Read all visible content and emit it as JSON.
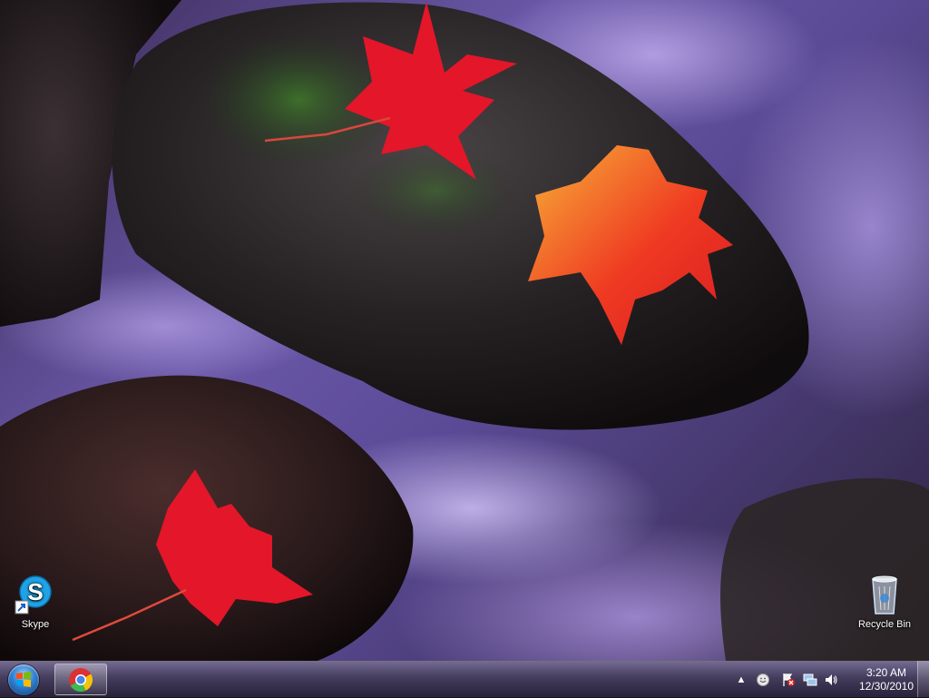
{
  "desktop": {
    "icons": [
      {
        "label": "Skype",
        "icon": "skype-icon"
      },
      {
        "label": "Recycle Bin",
        "icon": "recycle-bin-icon"
      }
    ]
  },
  "taskbar": {
    "start_icon": "windows-logo-icon",
    "pinned": [
      {
        "icon": "chrome-icon"
      }
    ],
    "tray": {
      "show_hidden_glyph": "▲",
      "icons": [
        "skype-status-icon",
        "action-center-icon",
        "network-icon",
        "volume-icon"
      ],
      "time": "3:20 AM",
      "date": "12/30/2010"
    }
  },
  "colors": {
    "accent": "#2f7fd0",
    "skype": "#1fa3e6",
    "chrome_red": "#db3236",
    "chrome_yellow": "#f4c20d",
    "chrome_green": "#3cba54",
    "chrome_blue": "#4885ed"
  }
}
